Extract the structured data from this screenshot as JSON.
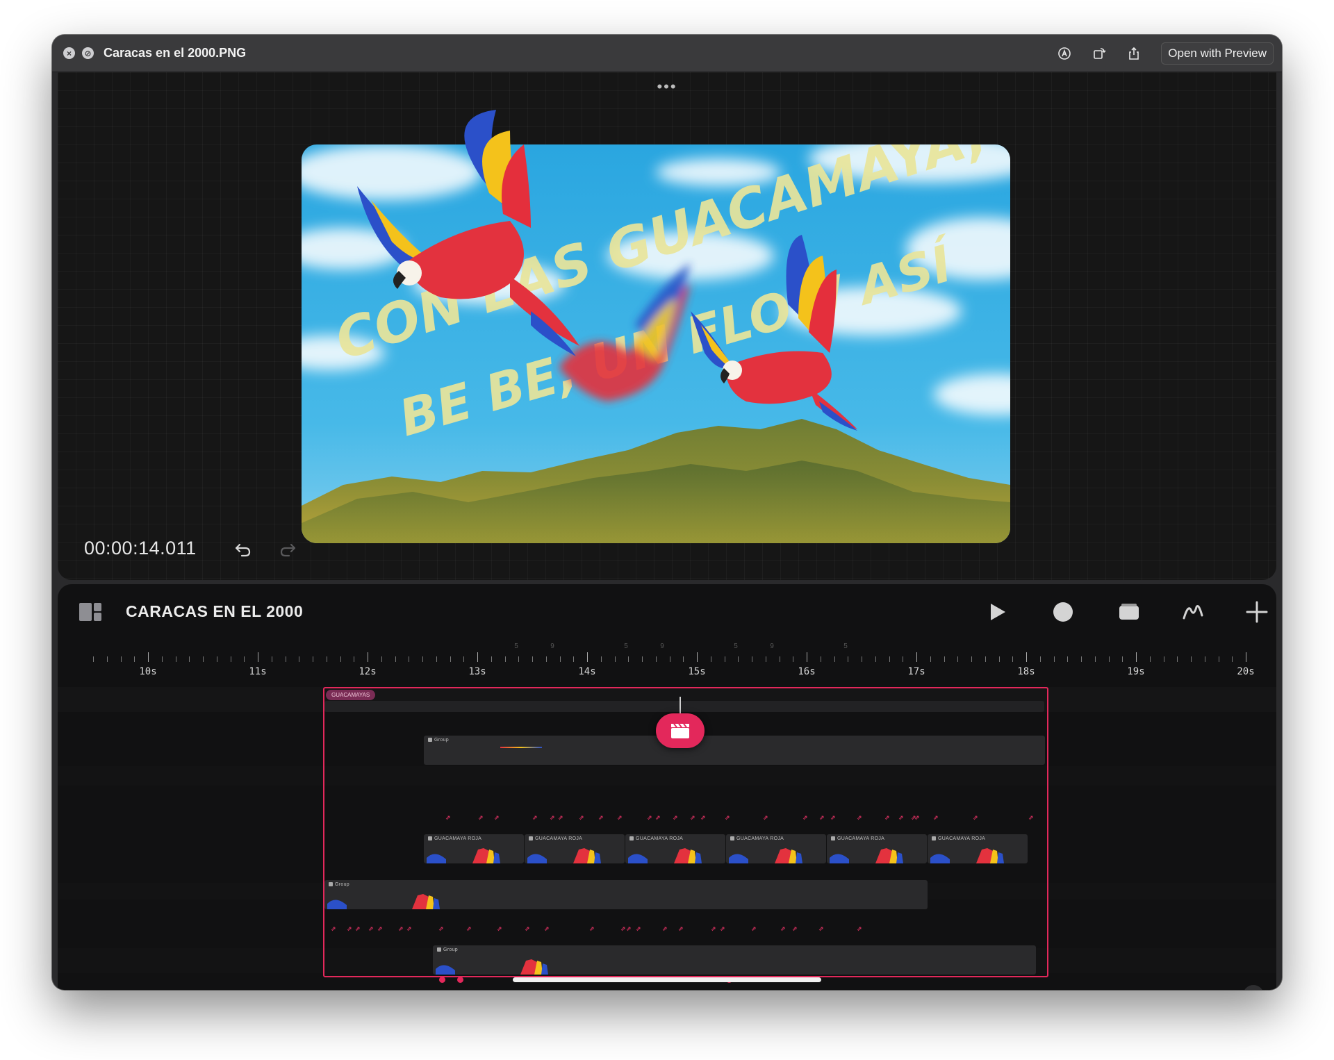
{
  "window": {
    "title": "Caracas en el 2000.PNG",
    "open_with_label": "Open with Preview",
    "toolbar_icons": [
      "markup-icon",
      "rotate-icon",
      "share-icon"
    ]
  },
  "preview": {
    "timecode": "00:00:14.011",
    "lyrics": [
      "CON LAS GUACAMAYA,",
      "BE BE, UN FLOW ASÍ"
    ]
  },
  "editor": {
    "project_title": "CARACAS EN EL 2000",
    "tools": [
      "play-icon",
      "record-icon",
      "layers-icon",
      "draw-icon",
      "add-icon"
    ],
    "ruler_labels": [
      "10s",
      "11s",
      "12s",
      "13s",
      "14s",
      "15s",
      "16s",
      "17s",
      "18s",
      "19s",
      "20s"
    ],
    "ruler_faint_labels": [
      "5",
      "9",
      "5",
      "9",
      "5",
      "9",
      "5"
    ],
    "group_tag": "GUACAMAYAS",
    "group_label": "Group",
    "clip_label": "GUACAMAYA ROJA",
    "colors": {
      "accent": "#e3285b",
      "sky": "#3db3e6",
      "lyrics": "#e9e59b"
    }
  }
}
